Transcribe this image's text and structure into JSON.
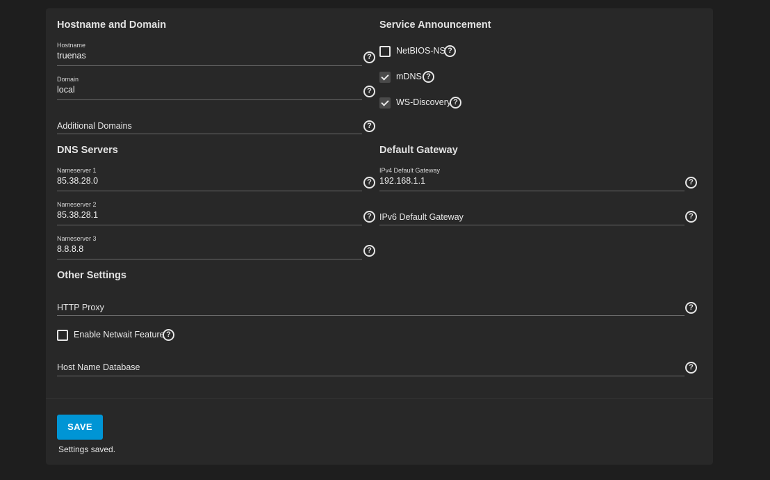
{
  "sections": {
    "hostname_domain": "Hostname and Domain",
    "service_announcement": "Service Announcement",
    "dns_servers": "DNS Servers",
    "default_gateway": "Default Gateway",
    "other_settings": "Other Settings"
  },
  "fields": {
    "hostname": {
      "label": "Hostname",
      "value": "truenas"
    },
    "domain": {
      "label": "Domain",
      "value": "local"
    },
    "additional_domains": {
      "placeholder": "Additional Domains"
    },
    "nameserver1": {
      "label": "Nameserver 1",
      "value": "85.38.28.0"
    },
    "nameserver2": {
      "label": "Nameserver 2",
      "value": "85.38.28.1"
    },
    "nameserver3": {
      "label": "Nameserver 3",
      "value": "8.8.8.8"
    },
    "ipv4_gateway": {
      "label": "IPv4 Default Gateway",
      "value": "192.168.1.1"
    },
    "ipv6_gateway": {
      "placeholder": "IPv6 Default Gateway"
    },
    "http_proxy": {
      "placeholder": "HTTP Proxy"
    },
    "host_name_database": {
      "placeholder": "Host Name Database"
    }
  },
  "checkboxes": {
    "netbios": {
      "label": "NetBIOS-NS",
      "checked": false
    },
    "mdns": {
      "label": "mDNS",
      "checked": true
    },
    "ws_discovery": {
      "label": "WS-Discovery",
      "checked": true
    },
    "netwait": {
      "label": "Enable Netwait Feature",
      "checked": false
    }
  },
  "help_icon_glyph": "?",
  "actions": {
    "save_label": "SAVE",
    "status_text": "Settings saved."
  },
  "colors": {
    "accent": "#0095d5",
    "background": "#1e1e1e",
    "card": "#282828"
  }
}
